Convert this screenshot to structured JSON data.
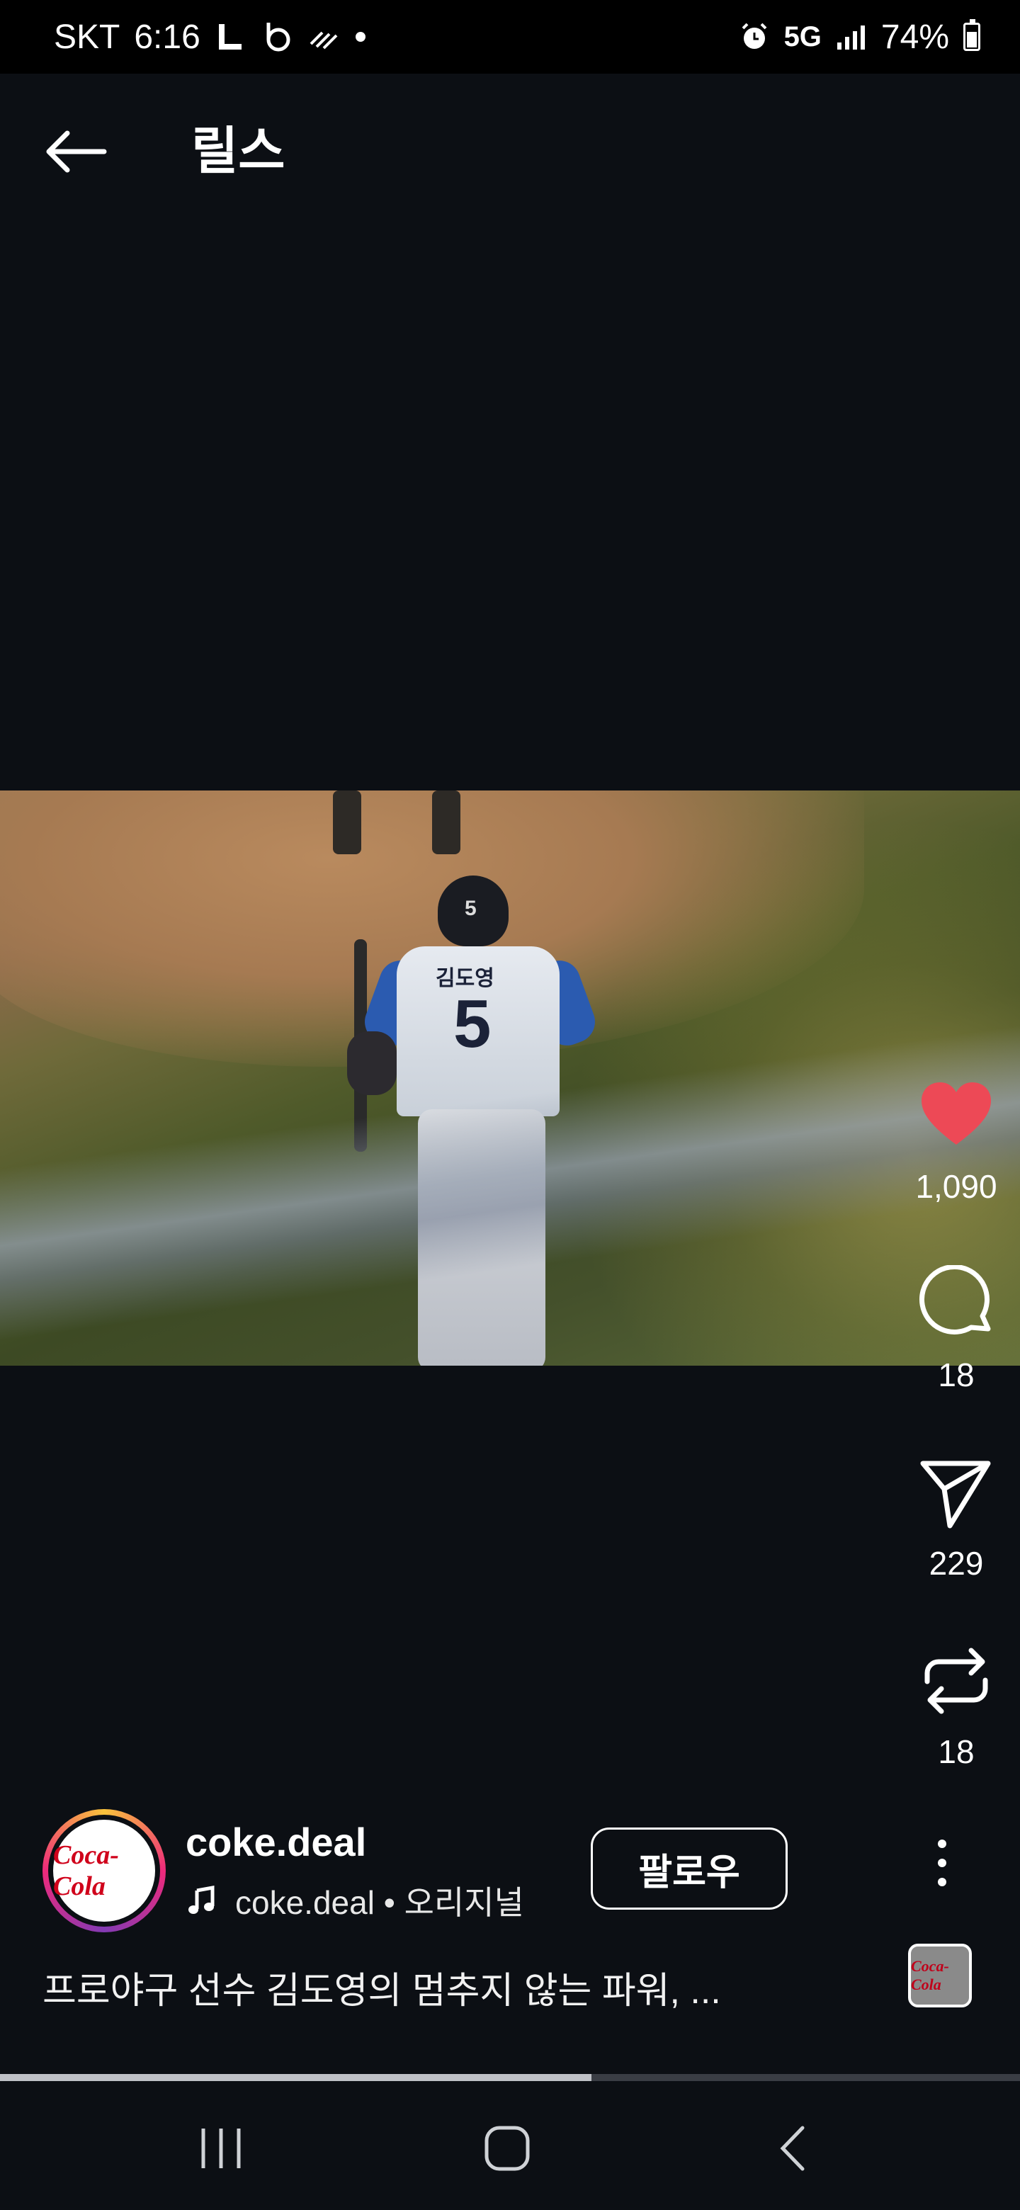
{
  "status_bar": {
    "carrier": "SKT",
    "time": "6:16",
    "network": "5G",
    "battery": "74%",
    "left_icons": [
      "l-app-icon",
      "b-app-icon",
      "signal-waves-icon",
      "notification-dot-icon"
    ],
    "right_icons": [
      "alarm-icon",
      "5g-icon",
      "signal-bars-icon",
      "battery-icon"
    ]
  },
  "header": {
    "title": "릴스"
  },
  "video": {
    "helmet_number": "5",
    "jersey_name": "김도영",
    "jersey_number": "5"
  },
  "actions": {
    "likes": "1,090",
    "comments": "18",
    "shares": "229",
    "remixes": "18"
  },
  "author": {
    "username": "coke.deal",
    "avatar_logo": "Coca-Cola",
    "audio_label": "coke.deal • 오리지널",
    "follow_label": "팔로우"
  },
  "caption": "프로야구 선수 김도영의 멈추지 않는 파워, ...",
  "audio_thumb_logo": "Coca-Cola",
  "progress": 0.58,
  "colors": {
    "background": "#0c0f14",
    "like": "#ed4956",
    "status_bar": "#000000"
  }
}
